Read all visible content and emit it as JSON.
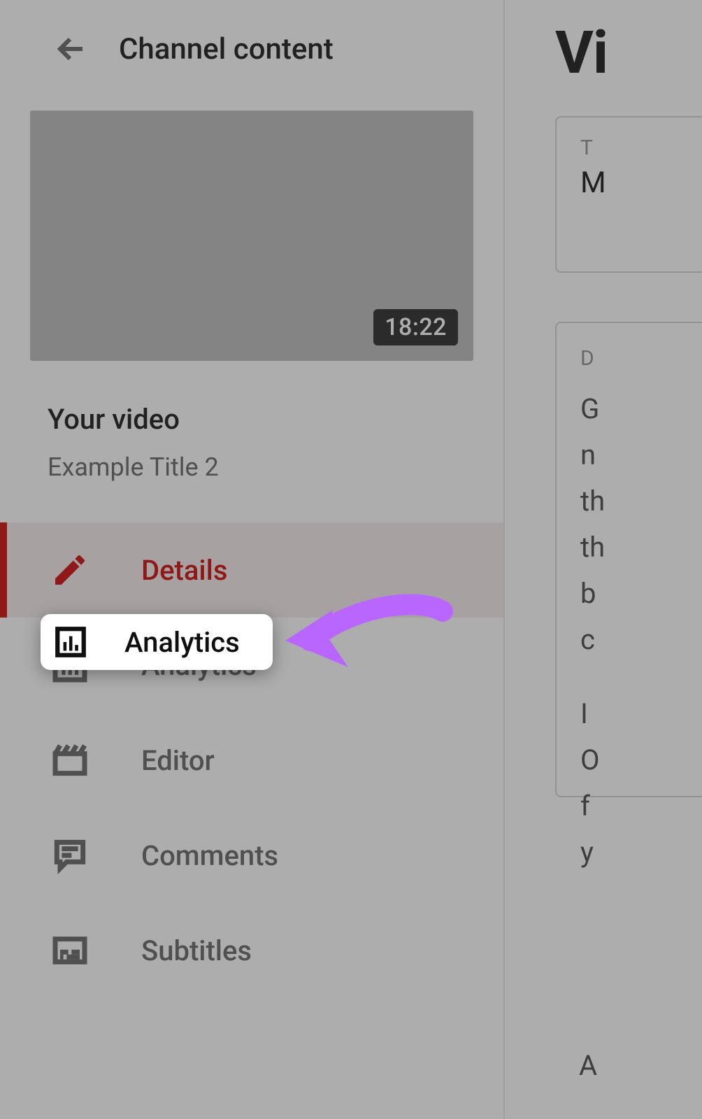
{
  "header": {
    "title": "Channel content"
  },
  "video": {
    "duration": "18:22",
    "section_label": "Your video",
    "title": "Example Title 2"
  },
  "nav": {
    "details": "Details",
    "analytics": "Analytics",
    "editor": "Editor",
    "comments": "Comments",
    "subtitles": "Subtitles"
  },
  "right": {
    "heading": "Vi",
    "title_label": "T",
    "title_value": "M",
    "desc_label": "D",
    "desc_para1_lines": [
      "G",
      "n",
      "th",
      "th",
      "b",
      "c"
    ],
    "desc_para2_lines": [
      "I",
      "O",
      "f",
      "y"
    ],
    "below": "A"
  },
  "annotation": {
    "target": "analytics"
  }
}
